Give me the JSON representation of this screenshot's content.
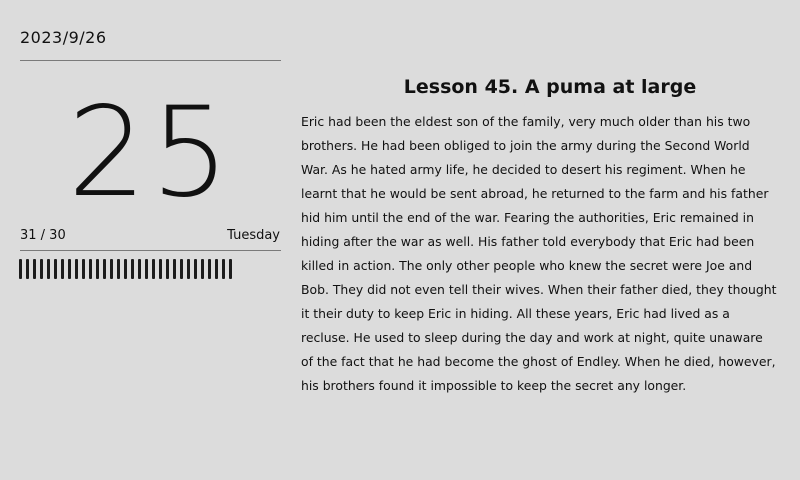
{
  "date": "2023/9/26",
  "big_number": "25",
  "progress": {
    "current": 31,
    "total": 30,
    "label": "31 / 30",
    "bar_count": 31
  },
  "weekday": "Tuesday",
  "lesson": {
    "title": "Lesson 45. A puma at large",
    "lines": [
      "Eric had been the eldest son of the family, very much older than his two",
      "brothers. He had been obliged to join the army during the Second World",
      "War. As he hated army life, he decided to desert his regiment. When he",
      "learnt that he would be sent abroad, he returned to the farm and his father",
      "hid him until the end of the war. Fearing the authorities, Eric remained in",
      "hiding after the war as well. His father told everybody that Eric had been",
      "killed in action. The only other people who knew the secret were Joe and",
      "Bob. They did not even tell their wives. When their father died, they thought",
      "it their duty to keep Eric in hiding. All these years, Eric had lived as a",
      "recluse. He used to sleep during the day and work at night, quite unaware",
      "of the fact that he had become the ghost of Endley. When he died, however,",
      "his brothers found it impossible to keep the secret any longer."
    ]
  }
}
